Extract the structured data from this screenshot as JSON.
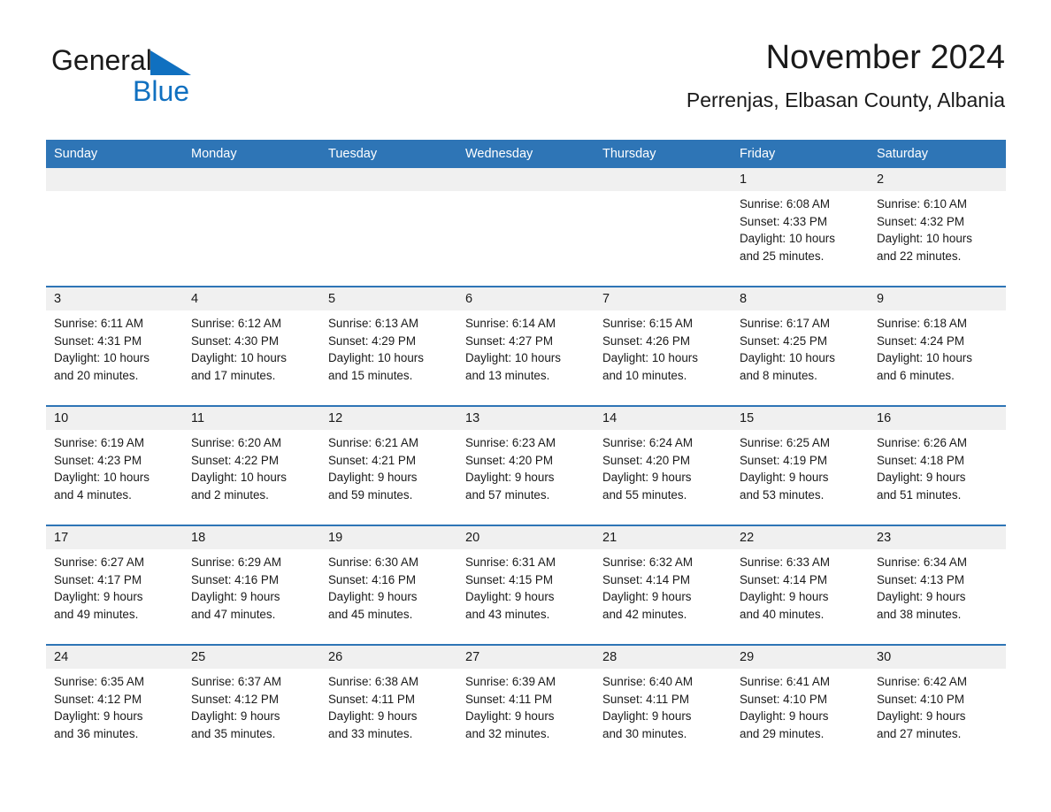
{
  "brand": {
    "name_part1": "General",
    "name_part2": "Blue",
    "triangle_color": "#1070c0"
  },
  "header": {
    "title": "November 2024",
    "subtitle": "Perrenjas, Elbasan County, Albania"
  },
  "theme": {
    "header_blue": "#2e75b6",
    "daynum_band": "#f0f0f0",
    "text": "#1a1a1a",
    "page_background": "#ffffff"
  },
  "weekday_headers": [
    "Sunday",
    "Monday",
    "Tuesday",
    "Wednesday",
    "Thursday",
    "Friday",
    "Saturday"
  ],
  "weeks": [
    [
      {
        "day": "",
        "sunrise": "",
        "sunset": "",
        "daylight_line1": "",
        "daylight_line2": ""
      },
      {
        "day": "",
        "sunrise": "",
        "sunset": "",
        "daylight_line1": "",
        "daylight_line2": ""
      },
      {
        "day": "",
        "sunrise": "",
        "sunset": "",
        "daylight_line1": "",
        "daylight_line2": ""
      },
      {
        "day": "",
        "sunrise": "",
        "sunset": "",
        "daylight_line1": "",
        "daylight_line2": ""
      },
      {
        "day": "",
        "sunrise": "",
        "sunset": "",
        "daylight_line1": "",
        "daylight_line2": ""
      },
      {
        "day": "1",
        "sunrise": "Sunrise: 6:08 AM",
        "sunset": "Sunset: 4:33 PM",
        "daylight_line1": "Daylight: 10 hours",
        "daylight_line2": "and 25 minutes."
      },
      {
        "day": "2",
        "sunrise": "Sunrise: 6:10 AM",
        "sunset": "Sunset: 4:32 PM",
        "daylight_line1": "Daylight: 10 hours",
        "daylight_line2": "and 22 minutes."
      }
    ],
    [
      {
        "day": "3",
        "sunrise": "Sunrise: 6:11 AM",
        "sunset": "Sunset: 4:31 PM",
        "daylight_line1": "Daylight: 10 hours",
        "daylight_line2": "and 20 minutes."
      },
      {
        "day": "4",
        "sunrise": "Sunrise: 6:12 AM",
        "sunset": "Sunset: 4:30 PM",
        "daylight_line1": "Daylight: 10 hours",
        "daylight_line2": "and 17 minutes."
      },
      {
        "day": "5",
        "sunrise": "Sunrise: 6:13 AM",
        "sunset": "Sunset: 4:29 PM",
        "daylight_line1": "Daylight: 10 hours",
        "daylight_line2": "and 15 minutes."
      },
      {
        "day": "6",
        "sunrise": "Sunrise: 6:14 AM",
        "sunset": "Sunset: 4:27 PM",
        "daylight_line1": "Daylight: 10 hours",
        "daylight_line2": "and 13 minutes."
      },
      {
        "day": "7",
        "sunrise": "Sunrise: 6:15 AM",
        "sunset": "Sunset: 4:26 PM",
        "daylight_line1": "Daylight: 10 hours",
        "daylight_line2": "and 10 minutes."
      },
      {
        "day": "8",
        "sunrise": "Sunrise: 6:17 AM",
        "sunset": "Sunset: 4:25 PM",
        "daylight_line1": "Daylight: 10 hours",
        "daylight_line2": "and 8 minutes."
      },
      {
        "day": "9",
        "sunrise": "Sunrise: 6:18 AM",
        "sunset": "Sunset: 4:24 PM",
        "daylight_line1": "Daylight: 10 hours",
        "daylight_line2": "and 6 minutes."
      }
    ],
    [
      {
        "day": "10",
        "sunrise": "Sunrise: 6:19 AM",
        "sunset": "Sunset: 4:23 PM",
        "daylight_line1": "Daylight: 10 hours",
        "daylight_line2": "and 4 minutes."
      },
      {
        "day": "11",
        "sunrise": "Sunrise: 6:20 AM",
        "sunset": "Sunset: 4:22 PM",
        "daylight_line1": "Daylight: 10 hours",
        "daylight_line2": "and 2 minutes."
      },
      {
        "day": "12",
        "sunrise": "Sunrise: 6:21 AM",
        "sunset": "Sunset: 4:21 PM",
        "daylight_line1": "Daylight: 9 hours",
        "daylight_line2": "and 59 minutes."
      },
      {
        "day": "13",
        "sunrise": "Sunrise: 6:23 AM",
        "sunset": "Sunset: 4:20 PM",
        "daylight_line1": "Daylight: 9 hours",
        "daylight_line2": "and 57 minutes."
      },
      {
        "day": "14",
        "sunrise": "Sunrise: 6:24 AM",
        "sunset": "Sunset: 4:20 PM",
        "daylight_line1": "Daylight: 9 hours",
        "daylight_line2": "and 55 minutes."
      },
      {
        "day": "15",
        "sunrise": "Sunrise: 6:25 AM",
        "sunset": "Sunset: 4:19 PM",
        "daylight_line1": "Daylight: 9 hours",
        "daylight_line2": "and 53 minutes."
      },
      {
        "day": "16",
        "sunrise": "Sunrise: 6:26 AM",
        "sunset": "Sunset: 4:18 PM",
        "daylight_line1": "Daylight: 9 hours",
        "daylight_line2": "and 51 minutes."
      }
    ],
    [
      {
        "day": "17",
        "sunrise": "Sunrise: 6:27 AM",
        "sunset": "Sunset: 4:17 PM",
        "daylight_line1": "Daylight: 9 hours",
        "daylight_line2": "and 49 minutes."
      },
      {
        "day": "18",
        "sunrise": "Sunrise: 6:29 AM",
        "sunset": "Sunset: 4:16 PM",
        "daylight_line1": "Daylight: 9 hours",
        "daylight_line2": "and 47 minutes."
      },
      {
        "day": "19",
        "sunrise": "Sunrise: 6:30 AM",
        "sunset": "Sunset: 4:16 PM",
        "daylight_line1": "Daylight: 9 hours",
        "daylight_line2": "and 45 minutes."
      },
      {
        "day": "20",
        "sunrise": "Sunrise: 6:31 AM",
        "sunset": "Sunset: 4:15 PM",
        "daylight_line1": "Daylight: 9 hours",
        "daylight_line2": "and 43 minutes."
      },
      {
        "day": "21",
        "sunrise": "Sunrise: 6:32 AM",
        "sunset": "Sunset: 4:14 PM",
        "daylight_line1": "Daylight: 9 hours",
        "daylight_line2": "and 42 minutes."
      },
      {
        "day": "22",
        "sunrise": "Sunrise: 6:33 AM",
        "sunset": "Sunset: 4:14 PM",
        "daylight_line1": "Daylight: 9 hours",
        "daylight_line2": "and 40 minutes."
      },
      {
        "day": "23",
        "sunrise": "Sunrise: 6:34 AM",
        "sunset": "Sunset: 4:13 PM",
        "daylight_line1": "Daylight: 9 hours",
        "daylight_line2": "and 38 minutes."
      }
    ],
    [
      {
        "day": "24",
        "sunrise": "Sunrise: 6:35 AM",
        "sunset": "Sunset: 4:12 PM",
        "daylight_line1": "Daylight: 9 hours",
        "daylight_line2": "and 36 minutes."
      },
      {
        "day": "25",
        "sunrise": "Sunrise: 6:37 AM",
        "sunset": "Sunset: 4:12 PM",
        "daylight_line1": "Daylight: 9 hours",
        "daylight_line2": "and 35 minutes."
      },
      {
        "day": "26",
        "sunrise": "Sunrise: 6:38 AM",
        "sunset": "Sunset: 4:11 PM",
        "daylight_line1": "Daylight: 9 hours",
        "daylight_line2": "and 33 minutes."
      },
      {
        "day": "27",
        "sunrise": "Sunrise: 6:39 AM",
        "sunset": "Sunset: 4:11 PM",
        "daylight_line1": "Daylight: 9 hours",
        "daylight_line2": "and 32 minutes."
      },
      {
        "day": "28",
        "sunrise": "Sunrise: 6:40 AM",
        "sunset": "Sunset: 4:11 PM",
        "daylight_line1": "Daylight: 9 hours",
        "daylight_line2": "and 30 minutes."
      },
      {
        "day": "29",
        "sunrise": "Sunrise: 6:41 AM",
        "sunset": "Sunset: 4:10 PM",
        "daylight_line1": "Daylight: 9 hours",
        "daylight_line2": "and 29 minutes."
      },
      {
        "day": "30",
        "sunrise": "Sunrise: 6:42 AM",
        "sunset": "Sunset: 4:10 PM",
        "daylight_line1": "Daylight: 9 hours",
        "daylight_line2": "and 27 minutes."
      }
    ]
  ]
}
